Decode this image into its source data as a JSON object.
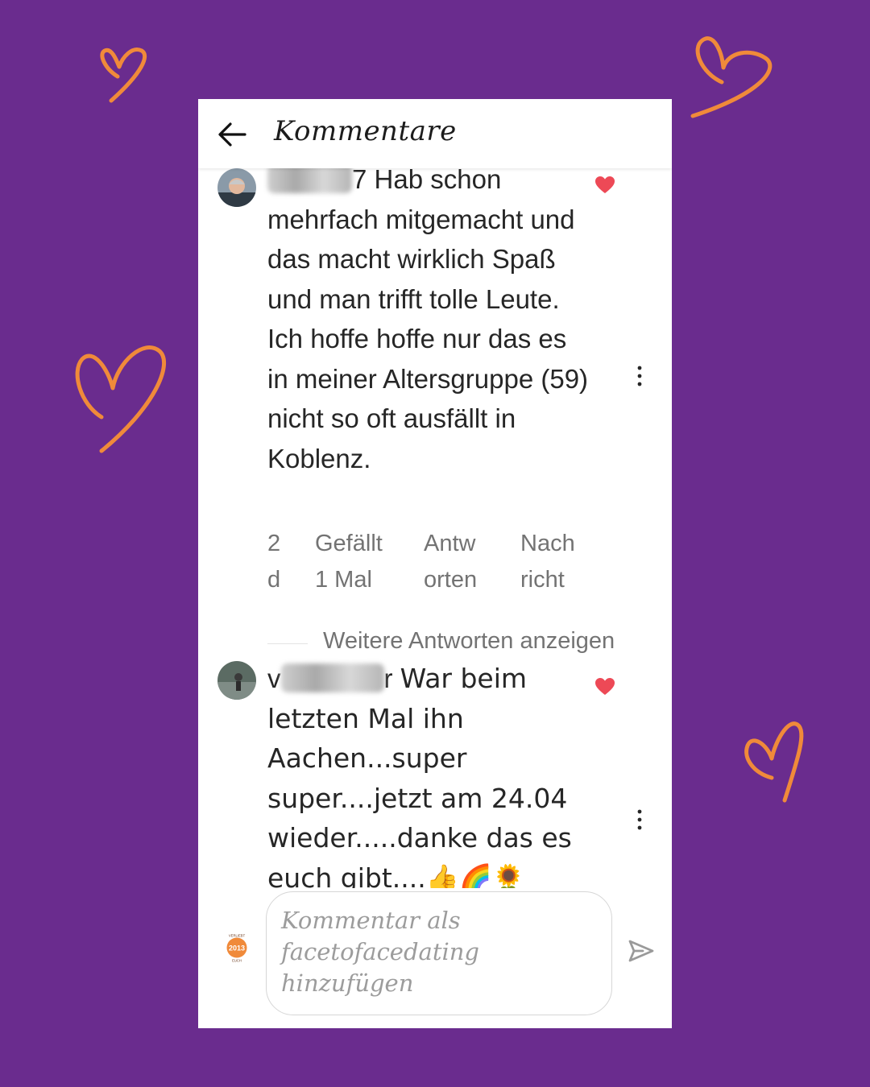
{
  "theme": {
    "background": "#6a2c8e",
    "accent": "#f08a3a",
    "like_color": "#ed4956"
  },
  "header": {
    "back_icon": "arrow-left-icon",
    "title": "Kommentare"
  },
  "comments": [
    {
      "username_prefix": "",
      "username_blurred": true,
      "username_suffix": "7",
      "text": "Hab schon mehrfach mitgemacht und das macht wirklich Spaß und man trifft tolle Leute. Ich hoffe hoffe nur das es in meiner Altersgruppe (59) nicht so oft ausfällt in Koblenz.",
      "time": "2\nd",
      "likes": "Gefällt\n1 Mal",
      "reply": "Antw\norten",
      "message": "Nach\nricht",
      "more_replies": "Weitere Antworten anzeigen"
    },
    {
      "username_prefix": "v",
      "username_blurred": true,
      "username_suffix": "r",
      "text": "War beim letzten Mal ihn Aachen...super super....jetzt am 24.04 wieder.....danke das es euch gibt....👍🌈🌻"
    }
  ],
  "composer": {
    "placeholder": "Kommentar als facetofacedating hinzufügen",
    "badge_year": "2013",
    "badge_top": "VERLIEBT",
    "badge_bottom": "EUCH",
    "send_icon": "send-icon"
  }
}
